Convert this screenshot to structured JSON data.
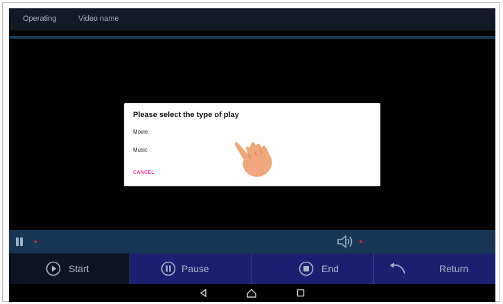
{
  "topbar": {
    "tabs": [
      "Operating",
      "Video name"
    ]
  },
  "dialog": {
    "title": "Please select the type of play",
    "options": [
      "Movie",
      "Music"
    ],
    "cancel_label": "CANCEL",
    "accent_color": "#e8348b"
  },
  "controls": {
    "start_label": "Start",
    "pause_label": "Pause",
    "end_label": "End",
    "return_label": "Return"
  },
  "icons": {
    "hand": "hand-pointer-icon",
    "pause": "pause-icon",
    "volume": "volume-icon",
    "play": "play-circle-icon",
    "stop": "stop-circle-icon",
    "return": "undo-arrow-icon"
  },
  "colors": {
    "background": "#020202",
    "button_bar": "#1a2070",
    "strip": "#173654"
  }
}
